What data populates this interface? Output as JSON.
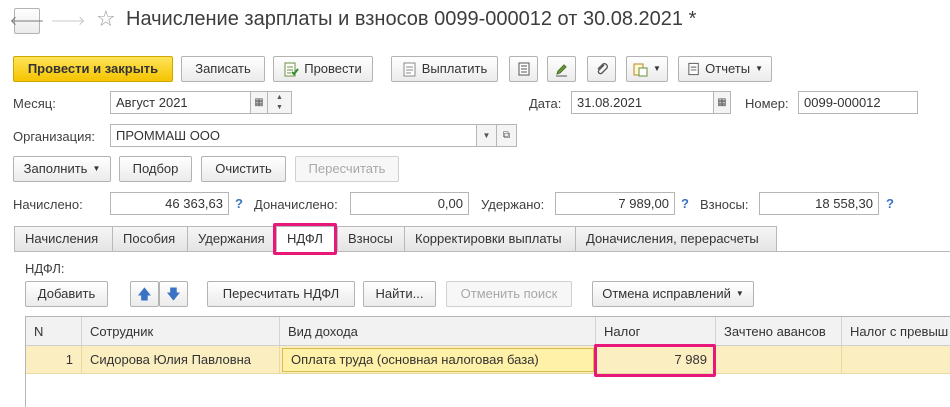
{
  "window": {
    "title": "Начисление зарплаты и взносов 0099-000012 от 30.08.2021 *",
    "favorite_glyph": "☆"
  },
  "toolbar": {
    "post_close": "Провести и закрыть",
    "save": "Записать",
    "post": "Провести",
    "pay": "Выплатить",
    "reports": "Отчеты"
  },
  "form": {
    "month_label": "Месяц:",
    "month_value": "Август 2021",
    "date_label": "Дата:",
    "date_value": "31.08.2021",
    "number_label": "Номер:",
    "number_value": "0099-000012",
    "org_label": "Организация:",
    "org_value": "ПРОММАШ ООО"
  },
  "actions": {
    "fill": "Заполнить",
    "select": "Подбор",
    "clear": "Очистить",
    "recalc": "Пересчитать"
  },
  "totals": {
    "accrued_label": "Начислено:",
    "accrued_value": "46 363,63",
    "additional_label": "Доначислено:",
    "additional_value": "0,00",
    "withheld_label": "Удержано:",
    "withheld_value": "7 989,00",
    "contrib_label": "Взносы:",
    "contrib_value": "18 558,30",
    "help": "?"
  },
  "tabs": [
    "Начисления",
    "Пособия",
    "Удержания",
    "НДФЛ",
    "Взносы",
    "Корректировки выплаты",
    "Доначисления, перерасчеты"
  ],
  "ndfl": {
    "section_label": "НДФЛ:",
    "add": "Добавить",
    "recalc_ndfl": "Пересчитать НДФЛ",
    "find": "Найти...",
    "cancel_search": "Отменить поиск",
    "cancel_corrections": "Отмена исправлений"
  },
  "table": {
    "headers": [
      "N",
      "Сотрудник",
      "Вид дохода",
      "Налог",
      "Зачтено авансов",
      "Налог с превыш"
    ],
    "rows": [
      {
        "n": "1",
        "employee": "Сидорова Юлия Павловна",
        "income_type": "Оплата труда (основная налоговая база)",
        "tax": "7 989",
        "advances": "",
        "excess_tax": ""
      }
    ]
  },
  "colors": {
    "accent_primary": "#f5c400",
    "highlight": "#e8177a",
    "selected_row": "#fbefc2",
    "help": "#3b73c4"
  }
}
